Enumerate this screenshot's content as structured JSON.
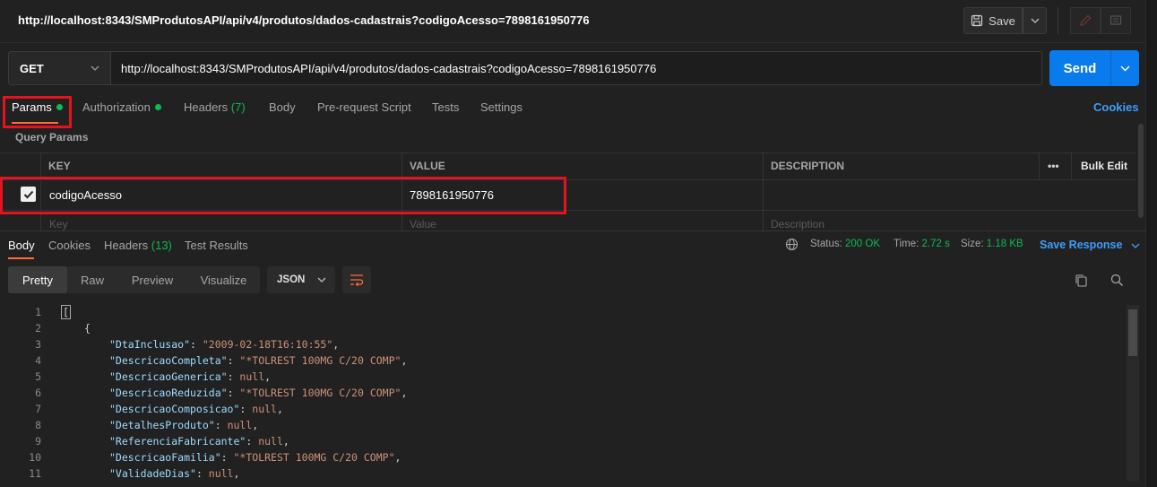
{
  "request": {
    "title": "http://localhost:8343/SMProdutosAPI/api/v4/produtos/dados-cadastrais?codigoAcesso=7898161950776",
    "method": "GET",
    "url": "http://localhost:8343/SMProdutosAPI/api/v4/produtos/dados-cadastrais?codigoAcesso=7898161950776",
    "save_label": "Save",
    "send_label": "Send"
  },
  "request_tabs": {
    "params": "Params",
    "authorization": "Authorization",
    "headers": "Headers",
    "headers_count": "(7)",
    "body": "Body",
    "prerequest": "Pre-request Script",
    "tests": "Tests",
    "settings": "Settings",
    "cookies": "Cookies"
  },
  "query_params": {
    "section_label": "Query Params",
    "columns": {
      "key": "KEY",
      "value": "VALUE",
      "description": "DESCRIPTION",
      "more": "•••",
      "bulk_edit": "Bulk Edit"
    },
    "rows": [
      {
        "enabled": true,
        "key": "codigoAcesso",
        "value": "7898161950776",
        "description": ""
      }
    ],
    "placeholders": {
      "key": "Key",
      "value": "Value",
      "description": "Description"
    }
  },
  "response_tabs": {
    "body": "Body",
    "cookies": "Cookies",
    "headers": "Headers",
    "headers_count": "(13)",
    "test_results": "Test Results"
  },
  "response_status": {
    "status_label": "Status:",
    "status_value": "200 OK",
    "time_label": "Time:",
    "time_value": "2.72 s",
    "size_label": "Size:",
    "size_value": "1.18 KB",
    "save_response": "Save Response"
  },
  "view_modes": {
    "pretty": "Pretty",
    "raw": "Raw",
    "preview": "Preview",
    "visualize": "Visualize",
    "format": "JSON"
  },
  "code_lines": [
    {
      "num": "1",
      "text": "["
    },
    {
      "num": "2",
      "text": "{"
    },
    {
      "num": "3",
      "key": "\"DtaInclusao\"",
      "value": "\"2009-02-18T16:10:55\""
    },
    {
      "num": "4",
      "key": "\"DescricaoCompleta\"",
      "value": "\"*TOLREST 100MG C/20 COMP\""
    },
    {
      "num": "5",
      "key": "\"DescricaoGenerica\"",
      "value": "null"
    },
    {
      "num": "6",
      "key": "\"DescricaoReduzida\"",
      "value": "\"*TOLREST 100MG C/20 COMP\""
    },
    {
      "num": "7",
      "key": "\"DescricaoComposicao\"",
      "value": "null"
    },
    {
      "num": "8",
      "key": "\"DetalhesProduto\"",
      "value": "null"
    },
    {
      "num": "9",
      "key": "\"ReferenciaFabricante\"",
      "value": "null"
    },
    {
      "num": "10",
      "key": "\"DescricaoFamilia\"",
      "value": "\"*TOLREST 100MG C/20 COMP\""
    },
    {
      "num": "11",
      "key": "\"ValidadeDias\"",
      "value": "null"
    }
  ],
  "colors": {
    "accent": "#ff6c37",
    "send": "#097bed",
    "ok": "#0cbb52",
    "highlight_box": "#e3141f",
    "link": "#3d9dfc"
  }
}
